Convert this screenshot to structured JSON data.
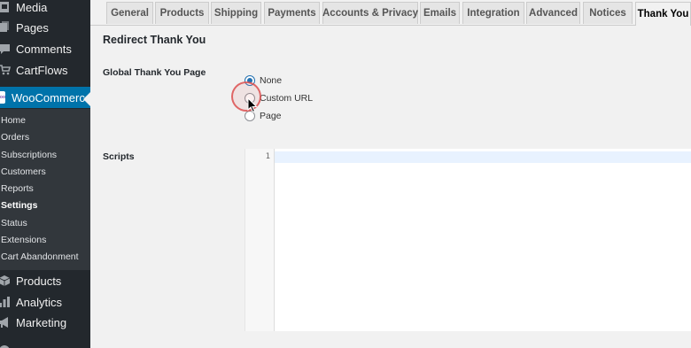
{
  "sidebar": {
    "items": [
      {
        "label": "Media",
        "icon": "media-icon"
      },
      {
        "label": "Pages",
        "icon": "pages-icon"
      },
      {
        "label": "Comments",
        "icon": "comments-icon"
      },
      {
        "label": "CartFlows",
        "icon": "cartflows-icon"
      },
      {
        "label": "WooCommerce",
        "icon": "woocommerce-icon"
      },
      {
        "label": "Products",
        "icon": "products-icon"
      },
      {
        "label": "Analytics",
        "icon": "analytics-icon"
      },
      {
        "label": "Marketing",
        "icon": "marketing-icon"
      }
    ],
    "woo_icon_text": "woo",
    "submenu": [
      "Home",
      "Orders",
      "Subscriptions",
      "Customers",
      "Reports",
      "Settings",
      "Status",
      "Extensions",
      "Cart Abandonment"
    ],
    "current_submenu": "Settings"
  },
  "tabs": [
    "General",
    "Products",
    "Shipping",
    "Payments",
    "Accounts & Privacy",
    "Emails",
    "Integration",
    "Advanced",
    "Notices",
    "Thank You"
  ],
  "active_tab": "Thank You",
  "section_title": "Redirect Thank You",
  "thank_you_field": {
    "label": "Global Thank You Page",
    "options": [
      "None",
      "Custom URL",
      "Page"
    ],
    "selected": "None"
  },
  "scripts_field": {
    "label": "Scripts",
    "line_number": "1"
  },
  "colors": {
    "sidebar_bg": "#23282d",
    "submenu_bg": "#32373c",
    "accent": "#0073aa",
    "radio_selected": "#2271b1",
    "click_ring": "#dc5050"
  }
}
